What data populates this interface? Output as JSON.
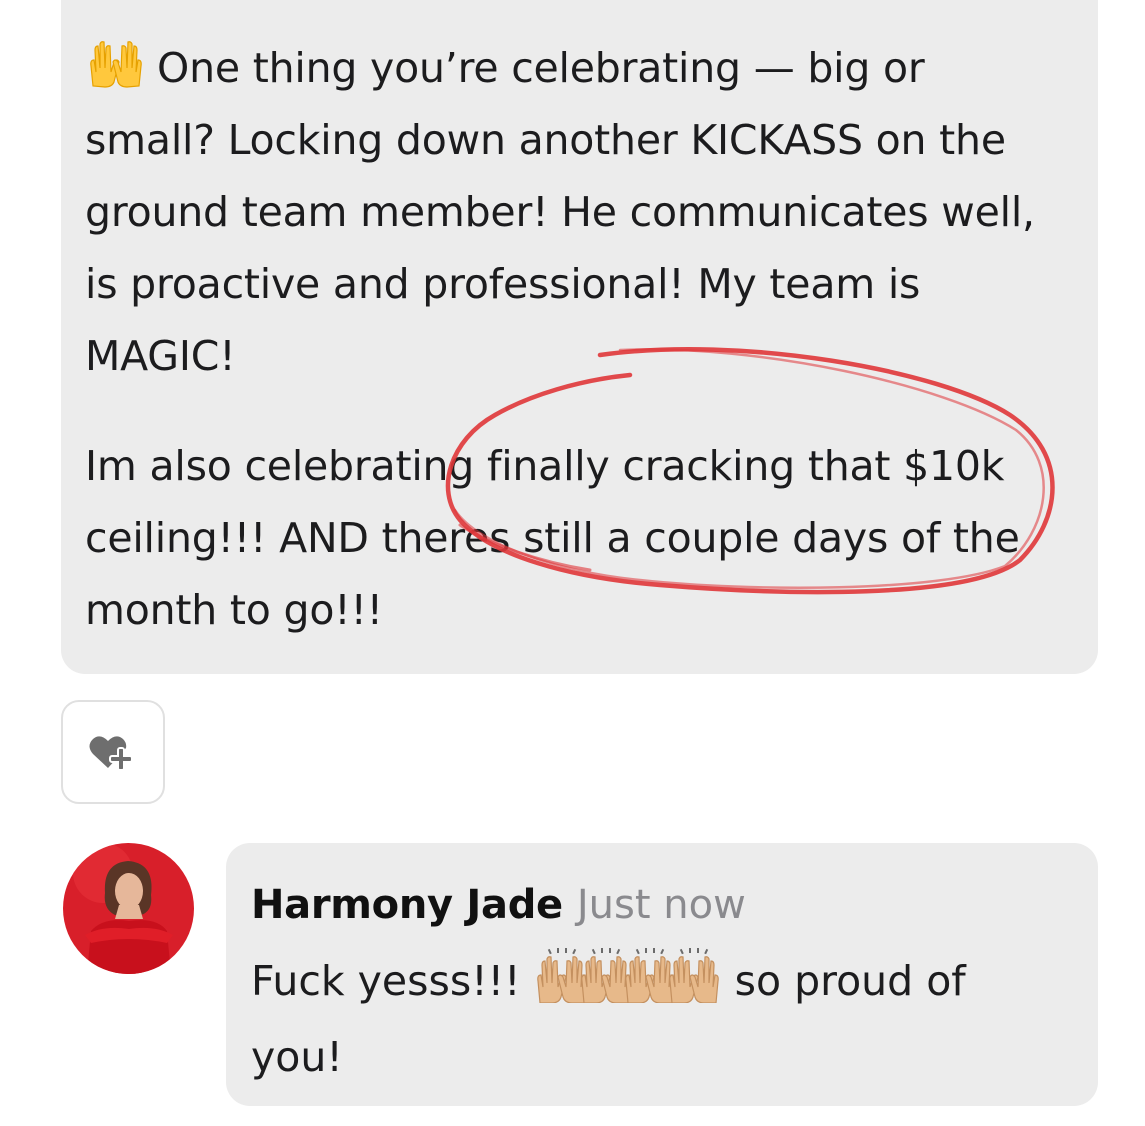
{
  "post": {
    "paragraph_1": "One thing you’re celebrating — big or small? Locking down another KICKASS on the ground team member! He communicates well, is proactive and professional! My team is MAGIC!",
    "paragraph_2": "Im also celebrating finally cracking that $10k ceiling!!! AND theres still a couple days of the month to go!!!",
    "leading_emoji": "raising-hands-icon"
  },
  "reaction": {
    "icon": "heart-plus-icon"
  },
  "comment": {
    "author": "Harmony Jade",
    "timestamp": "Just now",
    "text_before_emoji": "Fuck yesss!!!",
    "text_after_emoji": "so proud of you!",
    "emoji": "raising-hands-medium-light-skin-icon",
    "emoji_count": 4
  },
  "colors": {
    "bubble_bg": "#ececec",
    "annotation_red": "#e0373a",
    "timestamp_gray": "#8a8a8e",
    "avatar_bg": "#d81f2a"
  }
}
